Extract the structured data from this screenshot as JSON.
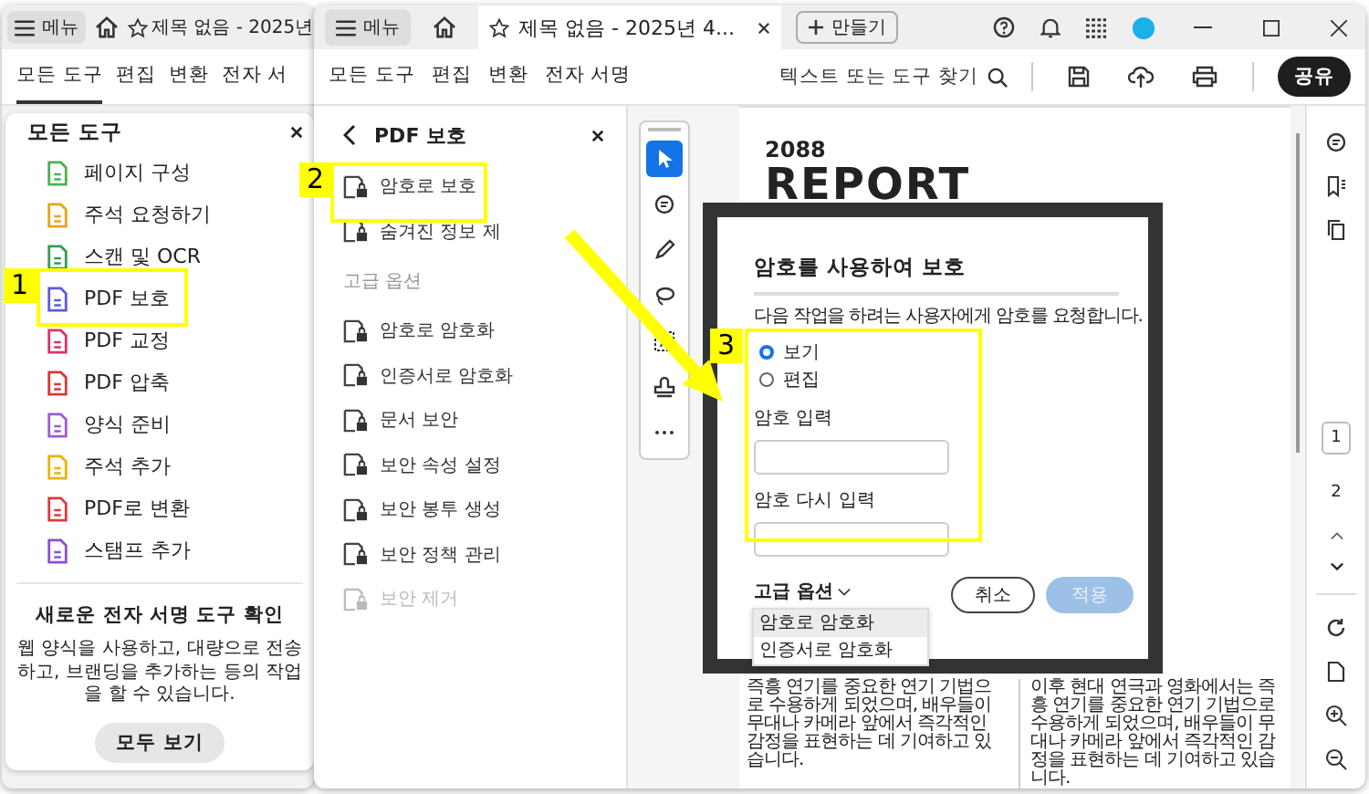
{
  "back_window": {
    "menu_label": "메뉴",
    "tab_title": "제목 없음 - 2025년",
    "tabs": [
      {
        "label": "모든 도구",
        "selected": true
      },
      {
        "label": "편집",
        "selected": false
      },
      {
        "label": "변환",
        "selected": false
      },
      {
        "label": "전자 서",
        "selected": false
      }
    ],
    "tools_panel": {
      "title": "모든 도구",
      "items": [
        {
          "label": "페이지 구성",
          "color": "#4caf50"
        },
        {
          "label": "주석 요청하기",
          "color": "#e8a317"
        },
        {
          "label": "스캔 및 OCR",
          "color": "#2e9e4f"
        },
        {
          "label": "PDF 보호",
          "color": "#5b5bd6"
        },
        {
          "label": "PDF 교정",
          "color": "#d6336c"
        },
        {
          "label": "PDF 압축",
          "color": "#d93636"
        },
        {
          "label": "양식 준비",
          "color": "#9c5bd6"
        },
        {
          "label": "주석 추가",
          "color": "#e8b400"
        },
        {
          "label": "PDF로 변환",
          "color": "#e03a3a"
        },
        {
          "label": "스탬프 추가",
          "color": "#8a4fd6"
        }
      ]
    },
    "promo": {
      "title": "새로운 전자 서명 도구 확인",
      "text": "웹 양식을 사용하고, 대량으로 전송하고, 브랜딩을 추가하는 등의 작업을 할 수 있습니다.",
      "button": "모두 보기"
    }
  },
  "front_window": {
    "menu_label": "메뉴",
    "tab_title": "제목 없음 - 2025년 4...",
    "new_button": "만들기",
    "tabs": [
      {
        "label": "모든 도구",
        "selected": false
      },
      {
        "label": "편집",
        "selected": false
      },
      {
        "label": "변환",
        "selected": false
      },
      {
        "label": "전자 서명",
        "selected": false
      }
    ],
    "search_placeholder": "텍스트 또는 도구 찾기",
    "share_button": "공유",
    "panel": {
      "title": "PDF 보호",
      "items": [
        {
          "kind": "item",
          "label": "암호로 보호",
          "disabled": false
        },
        {
          "kind": "item",
          "label": "숨겨진 정보 제",
          "disabled": false
        },
        {
          "kind": "section",
          "label": "고급 옵션"
        },
        {
          "kind": "item",
          "label": "암호로 암호화",
          "disabled": false
        },
        {
          "kind": "item",
          "label": "인증서로 암호화",
          "disabled": false
        },
        {
          "kind": "item",
          "label": "문서 보안",
          "disabled": false
        },
        {
          "kind": "item",
          "label": "보안 속성 설정",
          "disabled": false
        },
        {
          "kind": "item",
          "label": "보안 봉투 생성",
          "disabled": false
        },
        {
          "kind": "item",
          "label": "보안 정책 관리",
          "disabled": false
        },
        {
          "kind": "item",
          "label": "보안 제거",
          "disabled": true
        }
      ]
    },
    "tools": [
      {
        "selected": true
      },
      {
        "selected": false
      },
      {
        "selected": false
      },
      {
        "selected": false
      },
      {
        "selected": false
      },
      {
        "selected": false
      },
      {
        "selected": false
      }
    ],
    "document": {
      "number": "2088",
      "heading": "REPORT",
      "columns": [
        "즉흥 연기를 중요한 연기 기법으로 수용하게 되었으며, 배우들이 무대나 카메라 앞에서 즉각적인 감정을 표현하는 데 기여하고 있습니다.",
        "이후 현대 연극과 영화에서는 즉흥 연기를 중요한 연기 기법으로 수용하게 되었으며, 배우들이 무대나 카메라 앞에서 즉각적인 감정을 표현하는 데 기여하고 있습니다."
      ]
    },
    "dialog": {
      "title": "암호를 사용하여 보호",
      "description": "다음 작업을 하려는 사용자에게 암호를 요청합니다.",
      "radios": [
        {
          "label": "보기",
          "selected": true
        },
        {
          "label": "편집",
          "selected": false
        }
      ],
      "fields": [
        {
          "label": "암호 입력"
        },
        {
          "label": "암호 다시 입력"
        }
      ],
      "advanced": {
        "label": "고급 옵션",
        "expanded": true,
        "options": [
          {
            "label": "암호로 암호화",
            "selected": true
          },
          {
            "label": "인증서로 암호화",
            "selected": false
          }
        ]
      },
      "cancel_button": "취소",
      "apply_button": {
        "label": "적용",
        "disabled": true
      }
    },
    "pages": [
      {
        "label": "1",
        "selected": true
      },
      {
        "label": "2",
        "selected": false
      }
    ]
  },
  "annotations": [
    {
      "number": "1"
    },
    {
      "number": "2"
    },
    {
      "number": "3"
    }
  ]
}
